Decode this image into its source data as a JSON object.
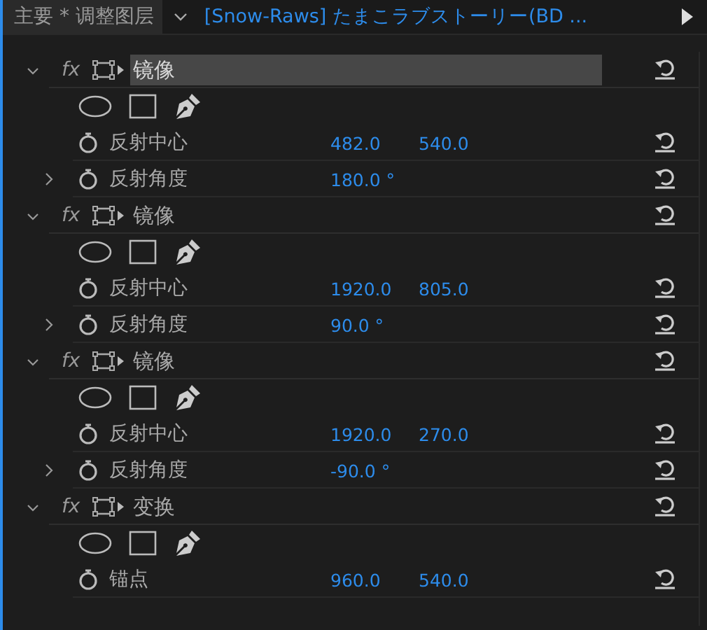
{
  "header": {
    "source": "主要 * 调整图层",
    "sequence": "[Snow-Raws] たまこラブストーリー(BD ..."
  },
  "effects": [
    {
      "name": "镜像",
      "badge": "fx",
      "expanded": true,
      "selected": true,
      "properties": [
        {
          "name": "反射中心",
          "expandable": false,
          "values": [
            "482.0",
            "540.0"
          ]
        },
        {
          "name": "反射角度",
          "expandable": true,
          "values": [
            "180.0 °"
          ]
        }
      ]
    },
    {
      "name": "镜像",
      "badge": "fx",
      "expanded": true,
      "selected": false,
      "properties": [
        {
          "name": "反射中心",
          "expandable": false,
          "values": [
            "1920.0",
            "805.0"
          ]
        },
        {
          "name": "反射角度",
          "expandable": true,
          "values": [
            "90.0 °"
          ]
        }
      ]
    },
    {
      "name": "镜像",
      "badge": "fx",
      "expanded": true,
      "selected": false,
      "properties": [
        {
          "name": "反射中心",
          "expandable": false,
          "values": [
            "1920.0",
            "270.0"
          ]
        },
        {
          "name": "反射角度",
          "expandable": true,
          "values": [
            "-90.0 °"
          ]
        }
      ]
    },
    {
      "name": "变换",
      "badge": "fx",
      "expanded": true,
      "selected": false,
      "properties": [
        {
          "name": "锚点",
          "expandable": false,
          "values": [
            "960.0",
            "540.0"
          ]
        }
      ]
    }
  ]
}
